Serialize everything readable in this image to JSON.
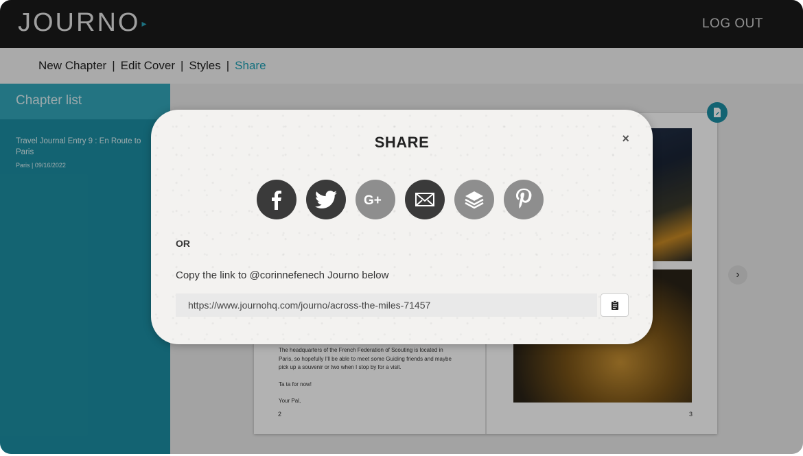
{
  "app": {
    "logo": "JOURNO",
    "logout_label": "LOG OUT"
  },
  "nav": {
    "items": [
      "New Chapter",
      "Edit Cover",
      "Styles",
      "Share"
    ],
    "active": "Share",
    "separator": "|"
  },
  "sidebar": {
    "heading": "Chapter list",
    "entries": [
      {
        "title": "Travel Journal Entry 9 : En Route to Paris",
        "meta": "Paris | 09/16/2022"
      }
    ]
  },
  "book": {
    "left_page_text": [
      "The headquarters of the French Federation of Scouting is located in Paris, so hopefully I'll be able to meet some Guiding friends and maybe pick up a souvenir or two when I stop by for a visit.",
      "Ta ta for now!",
      "Your Pal,"
    ],
    "left_page_number": "2",
    "right_page_number": "3"
  },
  "modal": {
    "title": "SHARE",
    "close_label": "×",
    "share_icons": [
      "facebook-icon",
      "twitter-icon",
      "google-plus-icon",
      "email-icon",
      "layers-icon",
      "pinterest-icon"
    ],
    "or_label": "OR",
    "copy_label": "Copy the link to @corinnefenech Journo below",
    "link_value": "https://www.journohq.com/journo/across-the-miles-71457"
  },
  "colors": {
    "accent": "#1c8fa4",
    "topbar": "#1b1b1b",
    "icon_dark": "#3a3a3a",
    "icon_grey": "#8e8e8e"
  }
}
